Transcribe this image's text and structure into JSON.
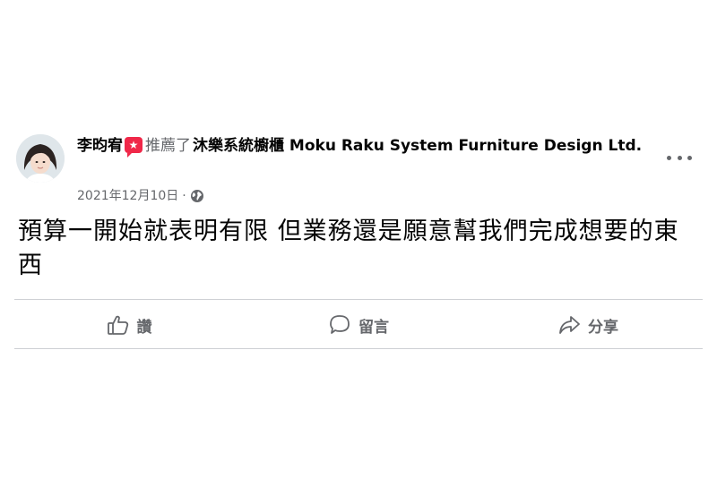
{
  "post": {
    "author": "李昀宥",
    "badge_glyph": "★",
    "verb": "推薦了",
    "page_name": "沐樂系統櫥櫃 Moku Raku System Furniture Design Ltd.",
    "date": "2021年12月10日",
    "separator": "·",
    "audience_icon": "globe-icon",
    "text": "預算一開始就表明有限 但業務還是願意幫我們完成想要的東西"
  },
  "actions": {
    "like_label": "讚",
    "comment_label": "留言",
    "share_label": "分享"
  },
  "colors": {
    "badge": "#f02849",
    "secondary_text": "#65676b",
    "primary_text": "#050505",
    "divider": "#ced0d4"
  }
}
